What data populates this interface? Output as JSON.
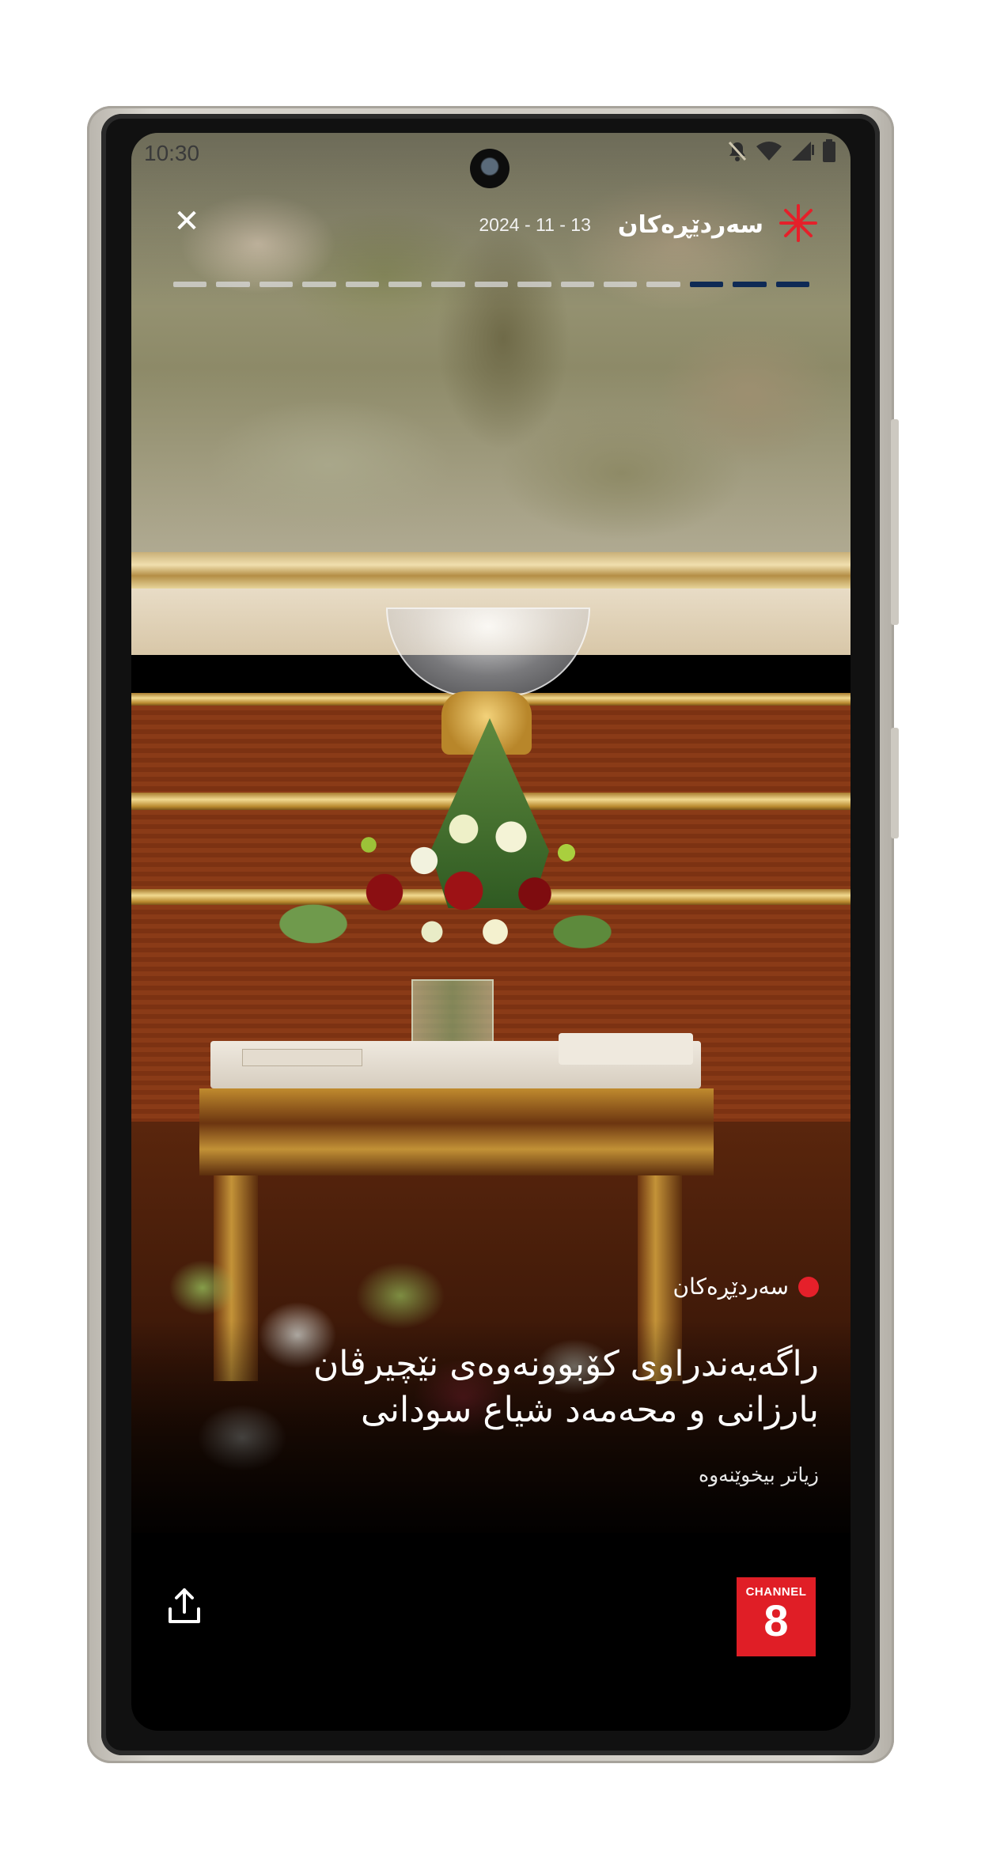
{
  "status_bar": {
    "time": "10:30",
    "icons": [
      "bell-off-icon",
      "wifi-icon",
      "signal-icon",
      "battery-icon"
    ]
  },
  "header": {
    "close_label": "✕",
    "date": "2024 - 11 - 13",
    "section_title": "سەردێڕەکان",
    "logo_icon": "asterisk-icon",
    "logo_color": "#e5202a"
  },
  "progress": {
    "total_segments": 15,
    "active_segments": 3,
    "active_color": "#0f2a55",
    "inactive_color": "#d9d9d9"
  },
  "story": {
    "category": "سەردێڕەکان",
    "headline": "راگەیەندراوی کۆبوونەوەی نێچیرڤان بارزانی و محەمەد شیاع سودانی",
    "read_more": "زیاتر بیخوێنەوە"
  },
  "footer": {
    "share_icon": "share-icon",
    "channel_logo_top": "CHANNEL",
    "channel_logo_number": "8",
    "channel_logo_color": "#e01e26"
  }
}
